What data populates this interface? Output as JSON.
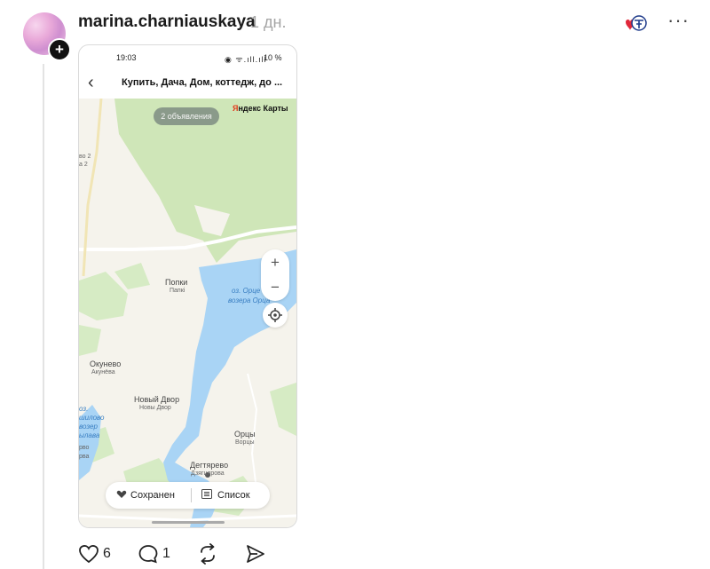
{
  "post": {
    "username": "marina.charniauskaya",
    "time_ago": "1 дн.",
    "more": "···"
  },
  "phone": {
    "status": {
      "time": "19:03",
      "icons": "◉ ᯤ.ıll.ıll",
      "battery": "10 %"
    },
    "appbar": {
      "back": "‹",
      "title": "Купить, Дача, Дом, коттедж, до ..."
    },
    "map": {
      "listings_pill": "2 объявления",
      "brand_first": "Я",
      "brand_rest": "ндекс Карты",
      "zoom_in": "+",
      "zoom_out": "−",
      "labels": {
        "popki": "Попки",
        "popki_by": "Папкі",
        "lake": "оз. Орце",
        "lake_by": "возера Орца",
        "okunevo": "Окунево",
        "okunevo_by": "Акунёва",
        "novy_dvor": "Новый Двор",
        "novy_dvor_by": "Новы Двор",
        "ortsy": "Орцы",
        "ortsy_by": "Ворцы",
        "degtyarevo": "Дегтярево",
        "degtyarevo_by": "Дзягцярова",
        "edge1": "во 2",
        "edge2": "а 2",
        "edge3": "оз.",
        "edge4": "шилово",
        "edge5": "возер",
        "edge6": "ылава",
        "edge7": "рво",
        "edge8": "рва"
      },
      "saved_label": "Сохранен",
      "list_label": "Список"
    }
  },
  "actions": {
    "likes": "6",
    "replies": "1"
  }
}
